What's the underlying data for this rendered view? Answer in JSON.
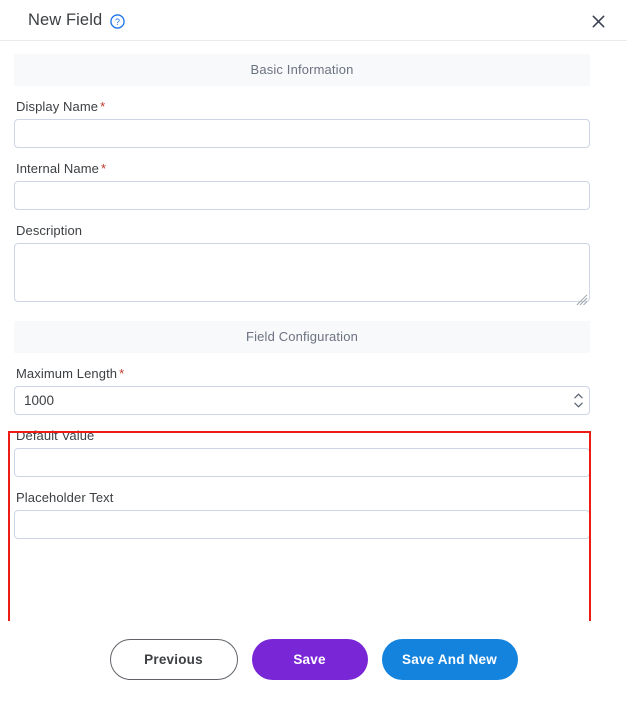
{
  "header": {
    "title": "New Field",
    "help_icon": "help-circle-icon",
    "close_icon": "close-icon"
  },
  "sections": [
    {
      "title": "Basic Information",
      "fields": [
        {
          "label": "Display Name",
          "required": true,
          "type": "text",
          "value": "",
          "placeholder": ""
        },
        {
          "label": "Internal Name",
          "required": true,
          "type": "text",
          "value": "",
          "placeholder": ""
        },
        {
          "label": "Description",
          "required": false,
          "type": "textarea",
          "value": "",
          "placeholder": ""
        }
      ]
    },
    {
      "title": "Field Configuration",
      "highlighted": true,
      "fields": [
        {
          "label": "Maximum Length",
          "required": true,
          "type": "number",
          "value": "1000",
          "placeholder": ""
        },
        {
          "label": "Default Value",
          "required": false,
          "type": "text",
          "value": "",
          "placeholder": ""
        },
        {
          "label": "Placeholder Text",
          "required": false,
          "type": "text",
          "value": "",
          "placeholder": ""
        }
      ]
    }
  ],
  "footer": {
    "previous_label": "Previous",
    "save_label": "Save",
    "save_and_new_label": "Save And New"
  },
  "colors": {
    "save": "#7927d6",
    "save_and_new": "#1383de",
    "highlight": "#ee1c16",
    "required_asterisk": "#c0392b",
    "help_icon": "#1a73e8"
  }
}
